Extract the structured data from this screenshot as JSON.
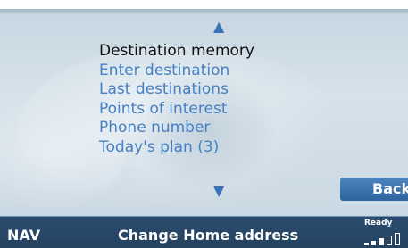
{
  "menu": {
    "scroll_up_icon": "triangle-up",
    "scroll_down_icon": "triangle-down",
    "items": [
      {
        "label": "Destination memory",
        "selected": true
      },
      {
        "label": "Enter destination",
        "selected": false
      },
      {
        "label": "Last destinations",
        "selected": false
      },
      {
        "label": "Points of interest",
        "selected": false
      },
      {
        "label": "Phone number",
        "selected": false
      },
      {
        "label": "Today's plan (3)",
        "selected": false
      }
    ]
  },
  "back_button": {
    "label": "Back"
  },
  "status_bar": {
    "mode": "NAV",
    "title": "Change Home address",
    "status_text": "Ready",
    "signal_level_of_5": 3
  },
  "colors": {
    "accent": "#4680c4",
    "selected_text": "#111111",
    "status_bar_bg": "#2c4d70",
    "button_bg": "#3a6fae"
  }
}
